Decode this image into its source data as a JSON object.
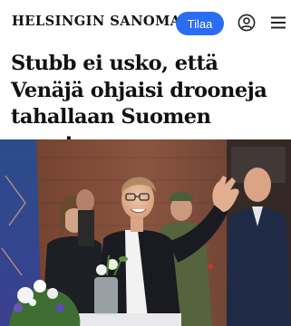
{
  "header": {
    "logo_text": "HELSINGIN SANOMAT",
    "subscribe_label": "Tilaa",
    "account_icon": "user-circle-icon",
    "menu_icon": "hamburger-menu-icon"
  },
  "article": {
    "headline": "Stubb ei usko, että Venäjä ohjaisi drooneja tahallaan Suomen suuntaan",
    "image_icon": "news-photo"
  },
  "colors": {
    "accent": "#2a6df4",
    "text": "#111111",
    "background": "#ffffff"
  }
}
